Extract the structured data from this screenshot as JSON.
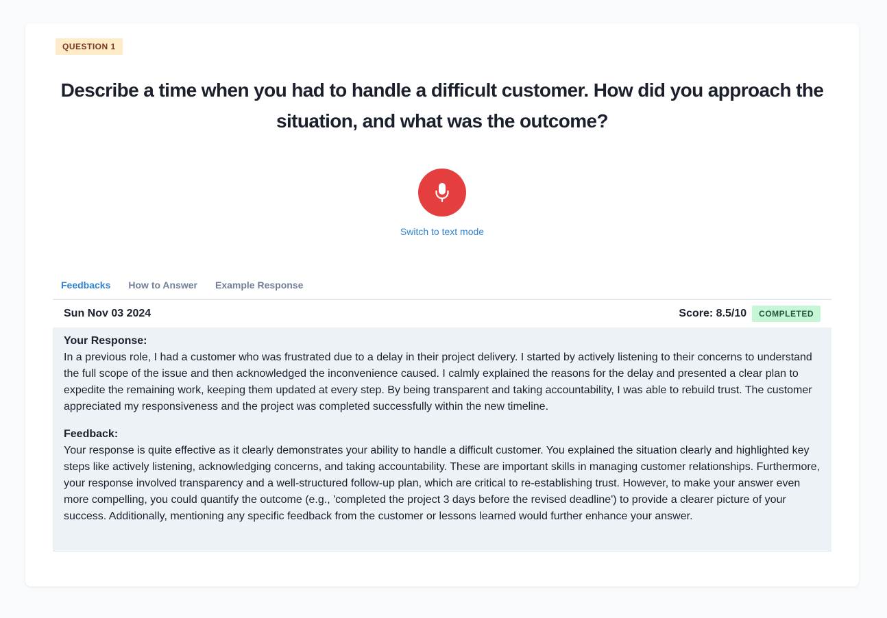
{
  "question": {
    "badge": "QUESTION 1",
    "text": "Describe a time when you had to handle a difficult customer. How did you approach the situation, and what was the outcome?"
  },
  "controls": {
    "mic_icon": "microphone-icon",
    "switch_mode_label": "Switch to text mode"
  },
  "tabs": [
    {
      "label": "Feedbacks",
      "active": true
    },
    {
      "label": "How to Answer",
      "active": false
    },
    {
      "label": "Example Response",
      "active": false
    }
  ],
  "feedback": {
    "date": "Sun Nov 03 2024",
    "score": "Score: 8.5/10",
    "status": "COMPLETED",
    "response_label": "Your Response:",
    "response_text": "In a previous role, I had a customer who was frustrated due to a delay in their project delivery. I started by actively listening to their concerns to understand the full scope of the issue and then acknowledged the inconvenience caused. I calmly explained the reasons for the delay and presented a clear plan to expedite the remaining work, keeping them updated at every step. By being transparent and taking accountability, I was able to rebuild trust. The customer appreciated my responsiveness and the project was completed successfully within the new timeline.",
    "feedback_label": "Feedback:",
    "feedback_text": "Your response is quite effective as it clearly demonstrates your ability to handle a difficult customer. You explained the situation clearly and highlighted key steps like actively listening, acknowledging concerns, and taking accountability. These are important skills in managing customer relationships. Furthermore, your response involved transparency and a well-structured follow-up plan, which are critical to re-establishing trust. However, to make your answer even more compelling, you could quantify the outcome (e.g., 'completed the project 3 days before the revised deadline') to provide a clearer picture of your success. Additionally, mentioning any specific feedback from the customer or lessons learned would further enhance your answer."
  },
  "colors": {
    "accent": "#3182ce",
    "record_button": "#e53e3e",
    "badge_question_bg": "#feebc8",
    "badge_status_bg": "#c6f6d5",
    "feedback_panel_bg": "#edf2f7"
  }
}
